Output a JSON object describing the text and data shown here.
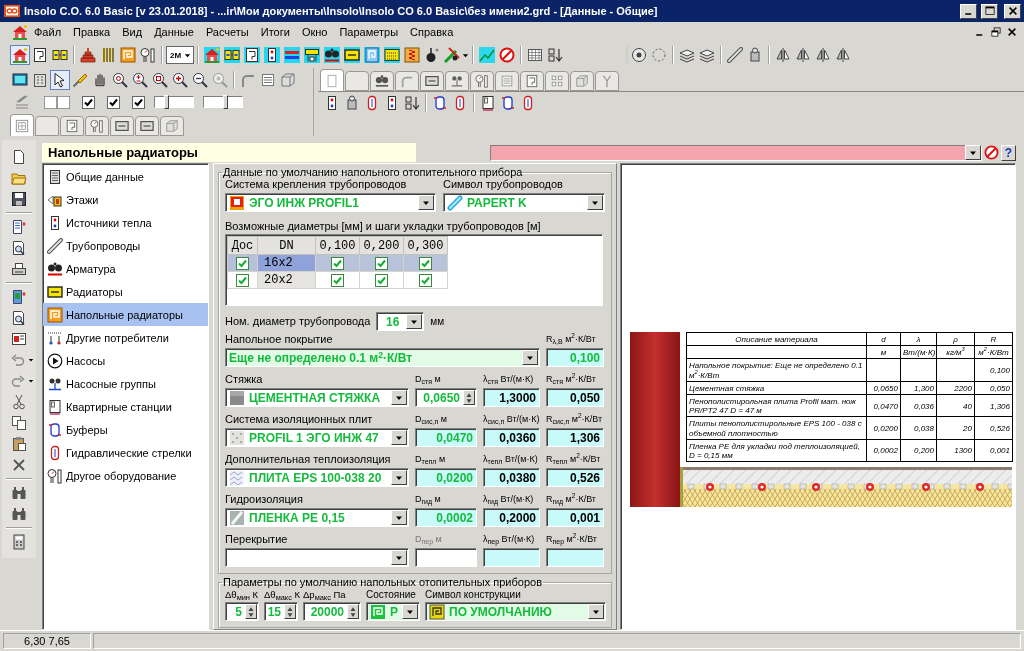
{
  "window": {
    "title": "Insolo C.O. 6.0 Basic [v 23.01.2018] - ...ir\\Мои документы\\Insolo\\Insolo CO 6.0 Basic\\без имени2.grd - [Данные - Общие]"
  },
  "menu": [
    "Файл",
    "Правка",
    "Вид",
    "Данные",
    "Расчеты",
    "Итоги",
    "Окно",
    "Параметры",
    "Справка"
  ],
  "modes": [
    {
      "on": true
    },
    {
      "on": false
    },
    {
      "on": false
    }
  ],
  "scale": "2M",
  "tools": [
    {
      "on": false
    },
    {
      "on": false
    },
    {
      "on": true
    },
    {
      "on": false
    },
    {
      "on": false
    },
    {
      "on": false
    },
    {
      "on": false
    },
    {
      "on": false
    },
    {
      "on": false
    },
    {
      "on": false
    },
    {
      "on": false
    }
  ],
  "view_tabs": [
    {
      "selected": true
    },
    {
      "selected": false
    },
    {
      "selected": false
    },
    {
      "selected": false
    },
    {
      "selected": false
    },
    {
      "selected": false
    },
    {
      "selected": false
    },
    {
      "selected": false
    },
    {
      "selected": false
    },
    {
      "selected": false
    },
    {
      "selected": false
    },
    {
      "selected": false
    }
  ],
  "checkboxes": [
    {
      "checked": true
    },
    {
      "checked": true
    },
    {
      "checked": true
    }
  ],
  "sliders": [
    {
      "level": 0.3
    },
    {
      "level": 0.55
    }
  ],
  "layer_tabs": [
    {
      "selected": true
    },
    {
      "selected": false
    },
    {
      "selected": false
    },
    {
      "selected": false
    },
    {
      "selected": false
    },
    {
      "selected": false
    },
    {
      "selected": false
    }
  ],
  "panel": {
    "title": "Напольные радиаторы",
    "help": "?"
  },
  "sidebar": {
    "items": [
      {
        "label": "Общие данные",
        "selected": false
      },
      {
        "label": "Этажи",
        "selected": false
      },
      {
        "label": "Источники тепла",
        "selected": false
      },
      {
        "label": "Трубопроводы",
        "selected": false
      },
      {
        "label": "Арматура",
        "selected": false
      },
      {
        "label": "Радиаторы",
        "selected": false
      },
      {
        "label": "Напольные радиаторы",
        "selected": true
      },
      {
        "label": "Другие потребители",
        "selected": false
      },
      {
        "label": "Насосы",
        "selected": false
      },
      {
        "label": "Насосные группы",
        "selected": false
      },
      {
        "label": "Квартирные станции",
        "selected": false
      },
      {
        "label": "Буферы",
        "selected": false
      },
      {
        "label": "Гидравлические стрелки",
        "selected": false
      },
      {
        "label": "Другое оборудование",
        "selected": false
      }
    ]
  },
  "form": {
    "title": "Данные по умолчанию напольного отопительного прибора",
    "mounting": {
      "label": "Система крепления трубопроводов",
      "value": "ЭГО ИНЖ PROFIL1"
    },
    "pipe_symbol": {
      "label": "Символ трубопроводов",
      "value": "PAPERT K"
    },
    "grid_caption": "Возможные диаметры [мм] и шаги укладки трубопроводов [м]",
    "grid": {
      "columns": [
        "Дос",
        "DN",
        "0,100",
        "0,200",
        "0,300"
      ],
      "rows": [
        {
          "selected": true,
          "checked": true,
          "dn": "16x2",
          "steps": [
            {
              "checked": true
            },
            {
              "checked": true
            },
            {
              "checked": true
            }
          ]
        },
        {
          "selected": false,
          "checked": true,
          "dn": "20x2",
          "steps": [
            {
              "checked": true
            },
            {
              "checked": true
            },
            {
              "checked": true
            }
          ]
        }
      ]
    },
    "nominal_diameter": {
      "label": "Ном. диаметр трубопровода",
      "value": "16",
      "unit": "мм"
    },
    "covering": {
      "label": "Напольное покрытие",
      "value": "Еще не определено 0.1 м$^{2}$·К/Вт",
      "r_label": "R$_{λ,В}$ м$^{2}$·К/Вт",
      "r_value": "0,100"
    },
    "layers": [
      {
        "label": "Стяжка",
        "material": "ЦЕМЕНТНАЯ СТЯЖКА",
        "fields": [
          {
            "kind": "spin",
            "label": "D$_{стя}$ м",
            "value": "0,0650"
          },
          {
            "kind": "fixed",
            "label": "λ$_{стя}$ Вт/(м·К)",
            "value": "1,3000"
          },
          {
            "kind": "fixed",
            "label": "R$_{стя}$ м$^{2}$·К/Вт",
            "value": "0,050"
          }
        ]
      },
      {
        "label": "Система изоляционных плит",
        "material": "PROFIL 1 ЭГО ИНЖ 47",
        "fields": [
          {
            "kind": "auto",
            "label": "D$_{сис,п}$ м",
            "value": "0,0470"
          },
          {
            "kind": "fixed",
            "label": "λ$_{сис,п}$ Вт/(м·К)",
            "value": "0,0360"
          },
          {
            "kind": "fixed",
            "label": "R$_{сис,п}$ м$^{2}$·К/Вт",
            "value": "1,306"
          }
        ]
      },
      {
        "label": "Дополнительная теплоизоляция",
        "material": "ПЛИТА EPS 100-038 20",
        "fields": [
          {
            "kind": "auto",
            "label": "D$_{тепл}$ м",
            "value": "0,0200"
          },
          {
            "kind": "fixed",
            "label": "λ$_{тепл}$ Вт/(м·К)",
            "value": "0,0380"
          },
          {
            "kind": "fixed",
            "label": "R$_{тепл}$ м$^{2}$·К/Вт",
            "value": "0,526"
          }
        ]
      },
      {
        "label": "Гидроизоляция",
        "material": "ПЛЕНКА PE 0,15",
        "fields": [
          {
            "kind": "auto",
            "label": "D$_{гид}$ м",
            "value": "0,0002"
          },
          {
            "kind": "fixed",
            "label": "λ$_{гид}$ Вт/(м·К)",
            "value": "0,2000"
          },
          {
            "kind": "fixed",
            "label": "R$_{гид}$ м$^{2}$·К/Вт",
            "value": "0,001"
          }
        ]
      },
      {
        "label": "Перекрытие",
        "fields": [
          {
            "kind": "blank",
            "label": "D$_{пер}$ м"
          },
          {
            "kind": "fixed",
            "label": "λ$_{пер}$ Вт/(м·К)"
          },
          {
            "kind": "fixed",
            "label": "R$_{пер}$ м$^{2}$·К/Вт"
          }
        ]
      }
    ]
  },
  "defaults": {
    "title": "Параметры по умолчанию напольных отопительных приборов",
    "fields": [
      {
        "kind": "spin",
        "label": "Δθ$_{мин}$ К",
        "value": "5"
      },
      {
        "kind": "spin",
        "label": "Δθ$_{макс}$ К",
        "value": "15"
      },
      {
        "kind": "spin",
        "label": "Δp$_{макс}$ Па",
        "value": "20000"
      },
      {
        "kind": "combo",
        "label": "Состояние",
        "value": "Р"
      },
      {
        "kind": "combo",
        "label": "Символ конструкции",
        "value": "ПО УМОЛЧАНИЮ"
      }
    ]
  },
  "preview": {
    "table": {
      "header": {
        "description": "Описание материала",
        "d": "d",
        "lambda": "λ",
        "rho": "ρ",
        "r": "R"
      },
      "units": {
        "d": "м",
        "lambda": "Вт/(м·К)",
        "rho": "кг/м$^{3}$",
        "r": "м$^{2}$·К/Вт"
      },
      "rows": [
        {
          "description": "Напольное покрытие: Еще не определено 0.1 м$^{2}$·К/Вт",
          "r": "0,100"
        },
        {
          "description": "Цементная стяжка",
          "d": "0,0650",
          "lambda": "1,300",
          "rho": "2200",
          "r": "0,050"
        },
        {
          "description": "Пенополистирольная плита Profil мат. нож PR/PT2 47 D = 47 м",
          "d": "0,0470",
          "lambda": "0,036",
          "rho": "40",
          "r": "1,306"
        },
        {
          "description": "Плиты пенополистирольные EPS 100 - 038 с объемной плотностью",
          "d": "0,0200",
          "lambda": "0,038",
          "rho": "20",
          "r": "0,526"
        },
        {
          "description": "Пленка PE для укладки под теплоизоляцией, D = 0,15 мм",
          "d": "0,0002",
          "lambda": "0,200",
          "rho": "1300",
          "r": "0,001"
        }
      ]
    }
  },
  "status_bar": {
    "coordinates": "6,30 7,65"
  }
}
